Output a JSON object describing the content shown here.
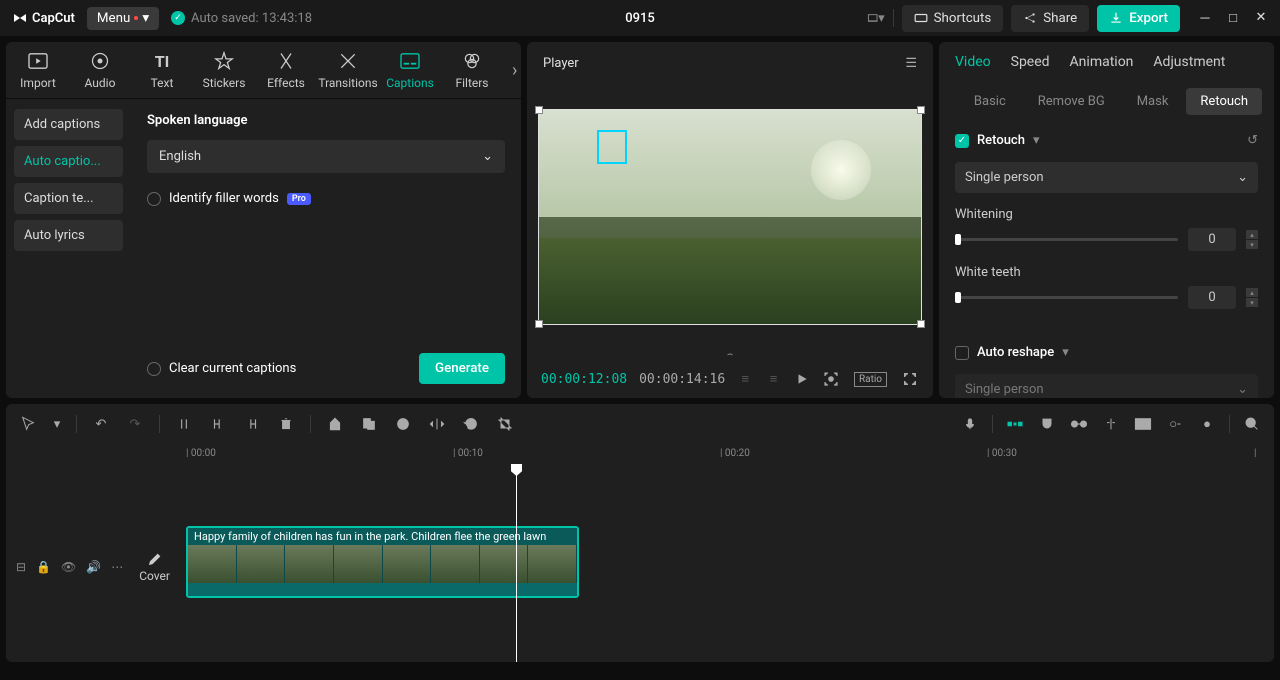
{
  "titlebar": {
    "app_name": "CapCut",
    "menu_label": "Menu",
    "autosave_text": "Auto saved: 13:43:18",
    "project_title": "0915",
    "shortcuts_label": "Shortcuts",
    "share_label": "Share",
    "export_label": "Export"
  },
  "media_tabs": [
    {
      "label": "Import"
    },
    {
      "label": "Audio"
    },
    {
      "label": "Text"
    },
    {
      "label": "Stickers"
    },
    {
      "label": "Effects"
    },
    {
      "label": "Transitions"
    },
    {
      "label": "Captions"
    },
    {
      "label": "Filters"
    }
  ],
  "caption_sidebar": [
    {
      "label": "Add captions"
    },
    {
      "label": "Auto captio..."
    },
    {
      "label": "Caption te..."
    },
    {
      "label": "Auto lyrics"
    }
  ],
  "captions_panel": {
    "language_title": "Spoken language",
    "language_value": "English",
    "filler_label": "Identify filler words",
    "pro_badge": "Pro",
    "clear_label": "Clear current captions",
    "generate_label": "Generate"
  },
  "player": {
    "title": "Player",
    "time_current": "00:00:12:08",
    "time_total": "00:00:14:16",
    "ratio_label": "Ratio"
  },
  "right_panel": {
    "tabs": [
      "Video",
      "Speed",
      "Animation",
      "Adjustment"
    ],
    "subtabs": [
      "Basic",
      "Remove BG",
      "Mask",
      "Retouch"
    ],
    "retouch_label": "Retouch",
    "person_mode": "Single person",
    "sliders": [
      {
        "label": "Whitening",
        "value": "0"
      },
      {
        "label": "White teeth",
        "value": "0"
      }
    ],
    "auto_reshape_label": "Auto reshape",
    "person_mode2": "Single person"
  },
  "timeline": {
    "marks": [
      "00:00",
      "00:10",
      "00:20",
      "00:30"
    ],
    "cover_label": "Cover",
    "clip_caption": "Happy family of children has fun in the park. Children flee the green lawn"
  }
}
